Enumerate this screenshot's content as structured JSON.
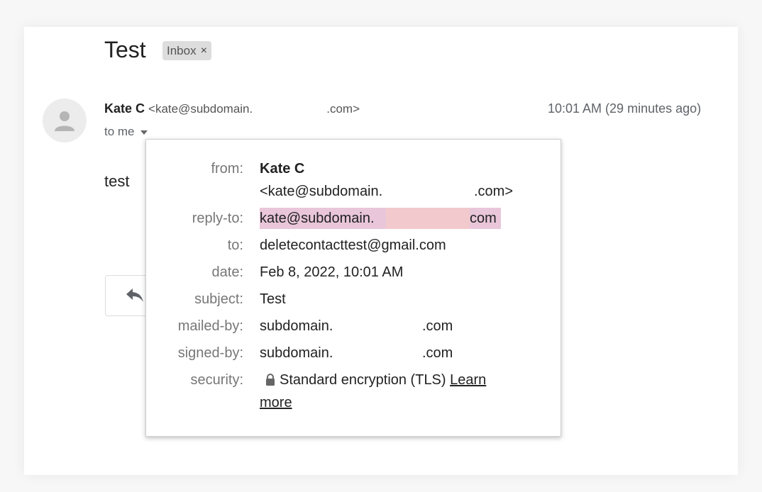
{
  "email": {
    "subject": "Test",
    "label_badge": "Inbox",
    "label_badge_close": "×",
    "sender_name": "Kate C",
    "sender_email_start": "<kate@subdomain.",
    "sender_email_end": ".com>",
    "timestamp": "10:01 AM (29 minutes ago)",
    "recipient_toggle": "to me",
    "body": "test"
  },
  "details": {
    "labels": {
      "from": "from:",
      "reply_to": "reply-to:",
      "to": "to:",
      "date": "date:",
      "subject": "subject:",
      "mailed_by": "mailed-by:",
      "signed_by": "signed-by:",
      "security": "security:"
    },
    "from_name": "Kate C",
    "from_email_start": "<kate@subdomain.",
    "from_email_end": ".com>",
    "reply_to_start": "kate@subdomain.",
    "reply_to_end": "com",
    "to": "deletecontacttest@gmail.com",
    "date": "Feb 8, 2022, 10:01 AM",
    "subject": "Test",
    "mailed_by_start": "subdomain.",
    "mailed_by_end": ".com",
    "signed_by_start": "subdomain.",
    "signed_by_end": ".com",
    "security_text": "Standard encryption (TLS)",
    "learn_more_1": "Learn",
    "learn_more_2": "more"
  },
  "icons": {
    "avatar": "person-icon",
    "reply": "reply-arrow-icon",
    "lock": "lock-icon",
    "caret": "caret-down-icon"
  }
}
